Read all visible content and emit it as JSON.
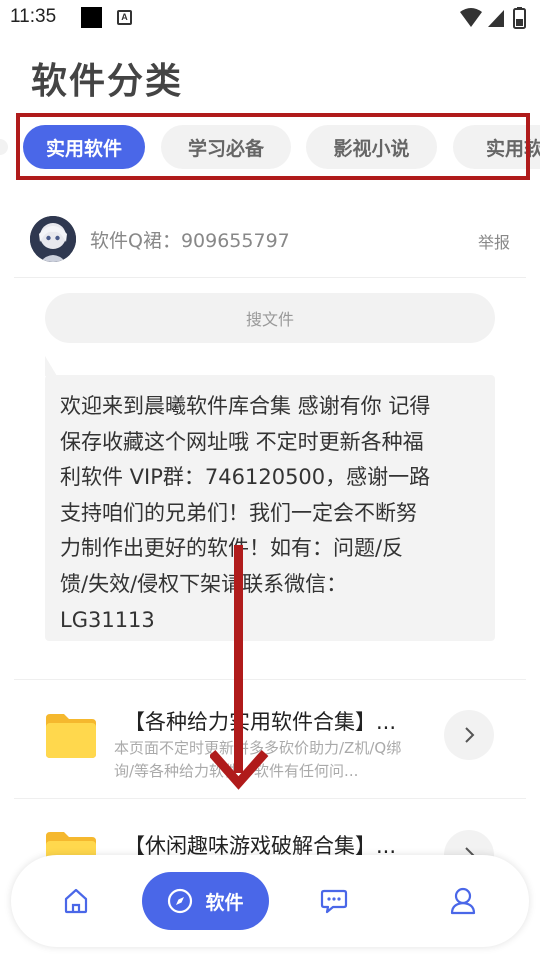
{
  "status_bar": {
    "time": "11:35",
    "notification_letter": "A"
  },
  "page_title": "软件分类",
  "tabs": [
    {
      "label": "实用软件",
      "active": true
    },
    {
      "label": "学习必备",
      "active": false
    },
    {
      "label": "影视小说",
      "active": false
    },
    {
      "label": "实用软",
      "active": false
    }
  ],
  "profile": {
    "group_text": "软件Q裙：909655797",
    "report_label": "举报"
  },
  "search": {
    "placeholder": "搜文件"
  },
  "notice": {
    "lines": [
      "欢迎来到晨曦软件库合集 感谢有你 记得",
      "保存收藏这个网址哦 不定时更新各种福",
      "利软件 VIP群：746120500，感谢一路",
      "支持咱们的兄弟们！我们一定会不断努",
      "力制作出更好的软件！如有：问题/反",
      "馈/失效/侵权下架请联系微信：",
      "LG31113"
    ]
  },
  "list": [
    {
      "title": "【各种给力实用软件合集】...",
      "desc_lines": [
        "本页面不定时更新拼多多砍价助力/Z机/Q绑",
        "询/等各种给力软件，软件有任何问..."
      ]
    },
    {
      "title": "【休闲趣味游戏破解合集】...",
      "desc_lines": []
    }
  ],
  "bottom_nav": {
    "items": [
      {
        "icon": "home-icon"
      },
      {
        "icon": "compass-icon",
        "label": "软件",
        "active": true
      },
      {
        "icon": "chat-icon"
      },
      {
        "icon": "user-icon"
      }
    ]
  },
  "colors": {
    "accent": "#4a67e8",
    "highlight_box": "#b01b1b",
    "arrow": "#b01b1b",
    "folder": "#ffd84d"
  }
}
